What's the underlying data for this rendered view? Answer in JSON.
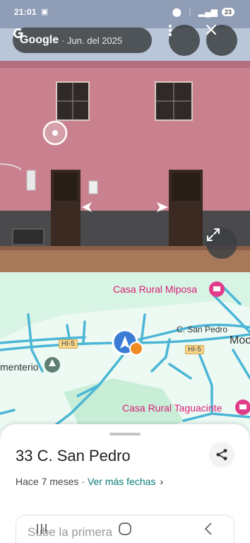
{
  "status_bar": {
    "time": "21:01",
    "battery": "23"
  },
  "street_view": {
    "brand": "Google",
    "capture_date": "· Jun. del 2025"
  },
  "map": {
    "pois": [
      "Casa Rural Miposa",
      "Casa Rural Taguacinte"
    ],
    "road_labels": [
      "C. San Pedro",
      "Moc",
      "menterio"
    ],
    "road_shields": [
      "HI-5",
      "HI-5"
    ]
  },
  "place": {
    "address": "33 C. San Pedro",
    "age": "Hace 7 meses ·",
    "more_dates": "Ver más fechas",
    "upload_prompt": "Sube la primera"
  },
  "colors": {
    "poi_pink": "#d61f78",
    "link_teal": "#0b7a7a",
    "wall_pink": "#c9808f",
    "map_green": "#d8f4e4",
    "road_blue": "#4bb6d6"
  }
}
